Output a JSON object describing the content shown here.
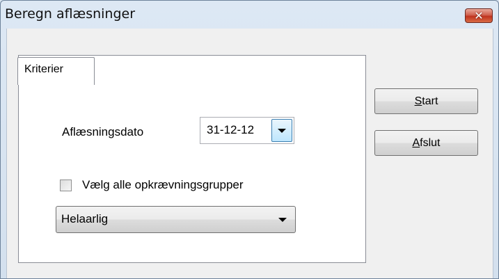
{
  "window": {
    "title": "Beregn aflæsninger",
    "close_icon": "close-icon"
  },
  "tabs": [
    {
      "label": "Kriterier",
      "selected": true
    }
  ],
  "form": {
    "date_label": "Aflæsningsdato",
    "date_value": "31-12-12",
    "select_all_label": "Vælg alle opkrævningsgrupper",
    "select_all_checked": false,
    "group_value": "Helaarlig"
  },
  "buttons": {
    "start": {
      "accel": "S",
      "rest": "tart"
    },
    "close": {
      "accel": "A",
      "rest": "fslut"
    }
  },
  "colors": {
    "title_bar": "#dbe6f2",
    "close_button": "#c73a26"
  }
}
